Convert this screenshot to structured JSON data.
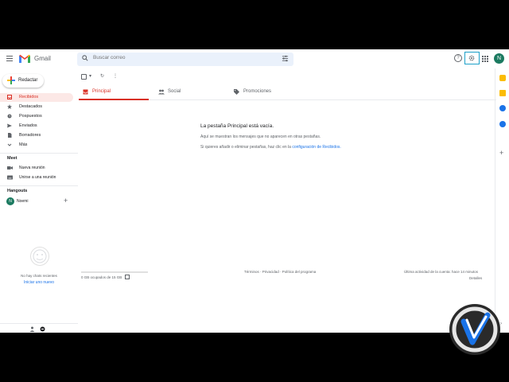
{
  "app": {
    "name": "Gmail"
  },
  "header": {
    "search_placeholder": "Buscar correo",
    "avatar_letter": "N"
  },
  "sidebar": {
    "compose": "Redactar",
    "items": [
      {
        "label": "Recibidos",
        "icon": "inbox-icon",
        "active": true
      },
      {
        "label": "Destacados",
        "icon": "star-icon"
      },
      {
        "label": "Pospuestos",
        "icon": "clock-icon"
      },
      {
        "label": "Enviados",
        "icon": "send-icon"
      },
      {
        "label": "Borradores",
        "icon": "draft-icon"
      },
      {
        "label": "Más",
        "icon": "chevron-down-icon"
      }
    ],
    "meet": {
      "title": "Meet",
      "items": [
        {
          "label": "Nueva reunión",
          "icon": "video-icon"
        },
        {
          "label": "Unirse a una reunión",
          "icon": "keyboard-icon"
        }
      ]
    },
    "hangouts": {
      "title": "Hangouts",
      "user": "Noemi",
      "avatar_letter": "N"
    },
    "chats": {
      "empty": "No hay chats recientes",
      "start": "Iniciar uno nuevo"
    }
  },
  "tabs": [
    {
      "label": "Principal",
      "icon": "inbox-icon",
      "active": true
    },
    {
      "label": "Social",
      "icon": "people-icon"
    },
    {
      "label": "Promociones",
      "icon": "tag-icon"
    }
  ],
  "empty_state": {
    "title": "La pestaña Principal está vacía.",
    "subtitle": "Aquí se muestran los mensajes que no aparecen en otras pestañas.",
    "hint_prefix": "Si quieres añadir o eliminar pestañas, haz clic en la",
    "hint_link": "configuración de Recibidos."
  },
  "footer": {
    "storage": "0 GB ocupados de 15 GB",
    "policies": "Términos · Privacidad · Política del programa",
    "activity": "Última actividad de la cuenta: hace 14 minutos",
    "details": "Detalles"
  },
  "colors": {
    "accent_red": "#d93025",
    "link_blue": "#1a73e8",
    "settings_highlight": "#1ea1c9"
  }
}
